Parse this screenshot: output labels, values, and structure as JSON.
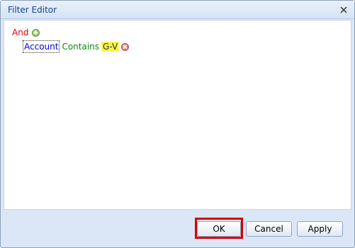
{
  "dialog": {
    "title": "Filter Editor"
  },
  "filter": {
    "group_operator": "And",
    "condition": {
      "field": "Account",
      "operator": "Contains",
      "value": "G-V"
    }
  },
  "buttons": {
    "ok_label": "OK",
    "cancel_label": "Cancel",
    "apply_label": "Apply"
  },
  "icons": {
    "close": "close-icon",
    "add": "add-condition-icon",
    "remove": "remove-condition-icon"
  },
  "colors": {
    "group_operator": "#e10000",
    "field": "#0000dd",
    "operator": "#0b8a0b",
    "value_highlight": "#f5f54a",
    "ok_highlight_border": "#d90000"
  }
}
